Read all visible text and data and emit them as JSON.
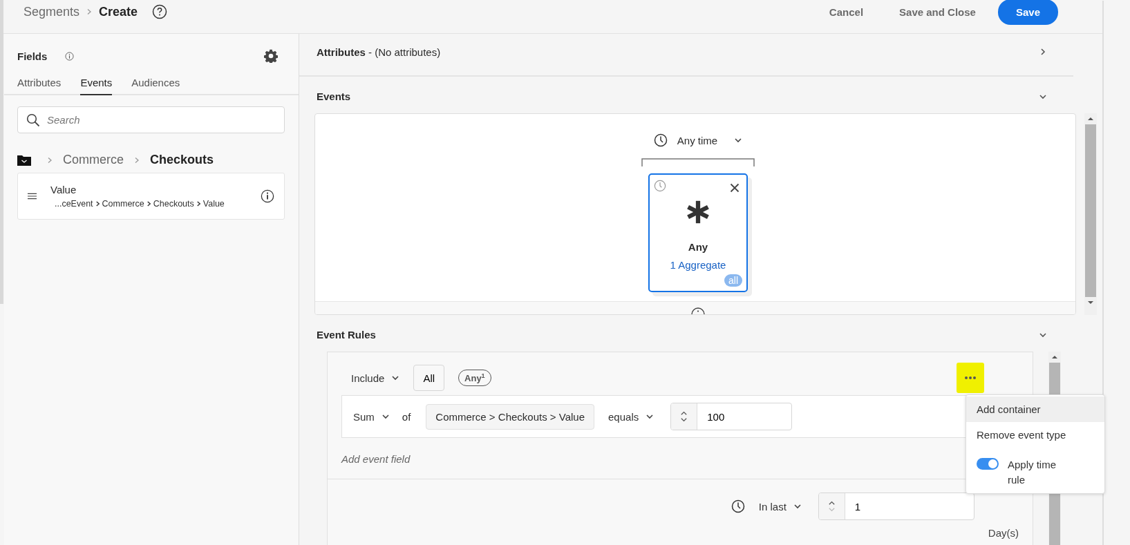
{
  "header": {
    "breadcrumb": [
      {
        "label": "Segments",
        "current": false
      },
      {
        "label": "Create",
        "current": true
      }
    ],
    "actions": [
      {
        "label": "Cancel",
        "kind": "quiet"
      },
      {
        "label": "Save and Close",
        "kind": "quiet"
      },
      {
        "label": "Save",
        "kind": "primary"
      }
    ]
  },
  "fields_panel": {
    "title": "Fields",
    "tabs": [
      {
        "label": "Attributes",
        "selected": false
      },
      {
        "label": "Events",
        "selected": true
      },
      {
        "label": "Audiences",
        "selected": false
      }
    ],
    "search": {
      "placeholder": "Search"
    },
    "path": [
      {
        "label": "Commerce",
        "current": false
      },
      {
        "label": "Checkouts",
        "current": true
      }
    ],
    "items": [
      {
        "name": "Value",
        "path": [
          "...ceEvent",
          "Commerce",
          "Checkouts",
          "Value"
        ]
      }
    ]
  },
  "attributes": {
    "title": "Attributes",
    "note": "- (No attributes)"
  },
  "events": {
    "title": "Events",
    "time": "Any time",
    "node": {
      "title": "Any",
      "link": "1 Aggregate",
      "badge": "all",
      "selected": true
    }
  },
  "event_rules": {
    "title": "Event Rules",
    "include": "Include",
    "all": "All",
    "any": "Any$^{1}$",
    "condition": {
      "function": "Sum",
      "of": "of",
      "field": "Commerce > Checkouts > Value",
      "operator": "equals",
      "value": "100"
    },
    "add_field": "Add event field",
    "time_rule": {
      "label": "In last",
      "value": "1",
      "unit": "Day(s)"
    },
    "menu": [
      {
        "kind": "item",
        "label": "Add container",
        "highlighted": true
      },
      {
        "kind": "item",
        "label": "Remove event type",
        "highlighted": false
      },
      {
        "kind": "toggle",
        "label": "Apply time rule",
        "on": true
      }
    ]
  }
}
